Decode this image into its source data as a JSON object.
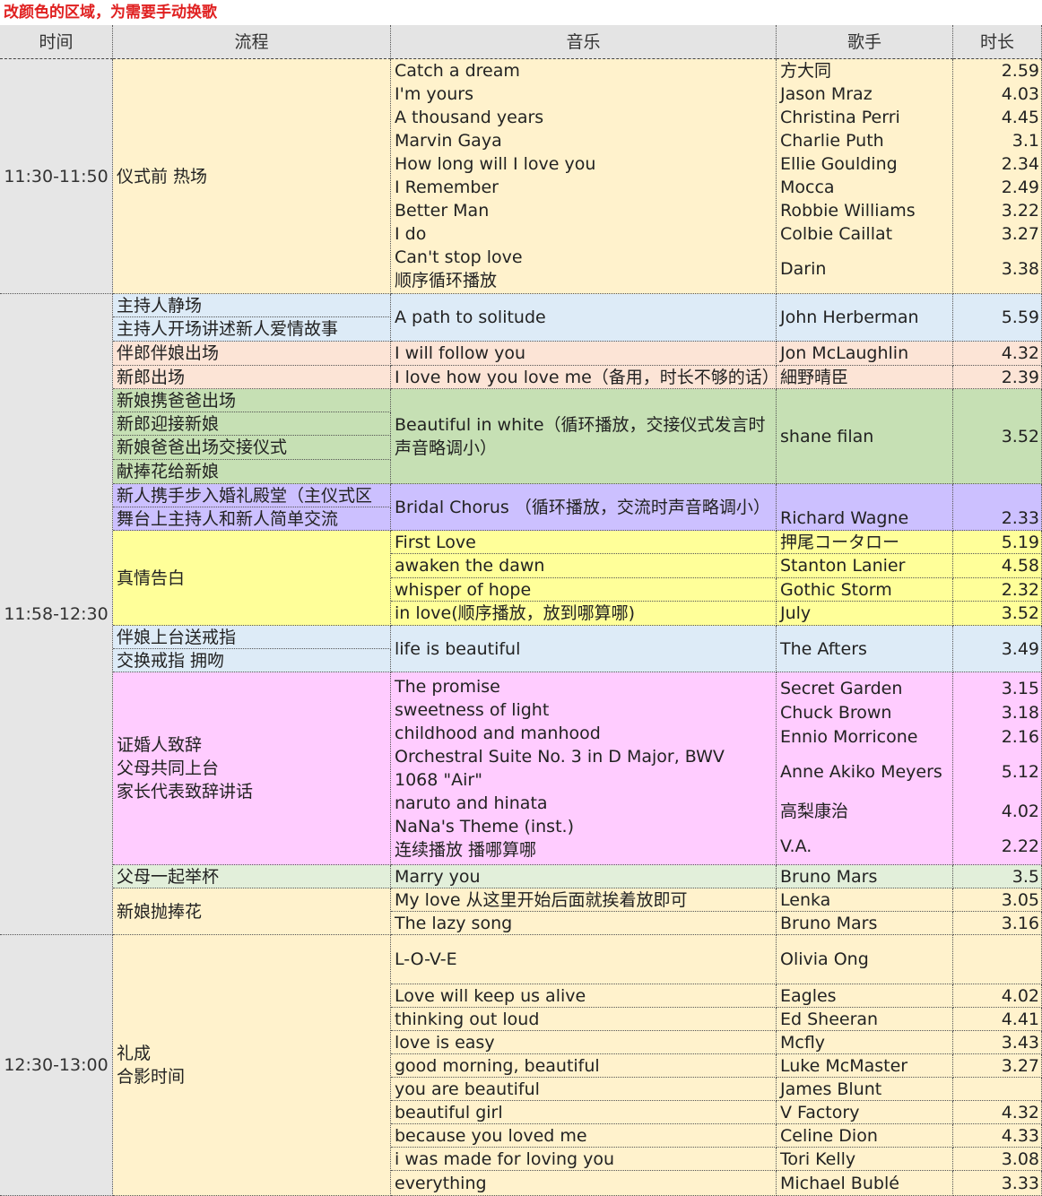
{
  "note": "改颜色的区域，为需要手动换歌",
  "headers": {
    "time": "时间",
    "process": "流程",
    "music": "音乐",
    "singer": "歌手",
    "duration": "时长"
  },
  "times": {
    "t1": "11:30-11:50",
    "t2": "11:58-12:30",
    "t3": "12:30-13:00"
  },
  "process": {
    "p1": "仪式前 热场",
    "p2": [
      "主持人静场",
      "主持人开场讲述新人爱情故事"
    ],
    "p3": [
      "伴郎伴娘出场",
      "新郎出场"
    ],
    "p4": [
      "新娘携爸爸出场",
      "新郎迎接新娘",
      "新娘爸爸出场交接仪式",
      "献捧花给新娘"
    ],
    "p5": [
      "新人携手步入婚礼殿堂（主仪式区",
      "舞台上主持人和新人简单交流"
    ],
    "p6": "真情告白",
    "p7": [
      "伴娘上台送戒指",
      "交换戒指 拥吻"
    ],
    "p8": [
      "证婚人致辞",
      "父母共同上台",
      "家长代表致辞讲话"
    ],
    "p9": "父母一起举杯",
    "p10": "新娘抛捧花",
    "p11": [
      "礼成",
      "合影时间"
    ]
  },
  "rows": {
    "r1": {
      "music": [
        "Catch a dream",
        "I'm yours",
        "A thousand years",
        "Marvin Gaya",
        "How long will I love you",
        "I Remember",
        "Better Man",
        "I do",
        "Can't stop love",
        "顺序循环播放"
      ],
      "singer": [
        "方大同",
        "Jason Mraz",
        "Christina Perri",
        "Charlie Puth",
        "Ellie Goulding",
        "Mocca",
        "Robbie Williams",
        "Colbie Caillat",
        "Darin"
      ],
      "dur": [
        "2.59",
        "4.03",
        "4.45",
        "3.1",
        "2.34",
        "2.49",
        "3.22",
        "3.27",
        "3.38"
      ]
    },
    "r2": {
      "music": "A path to solitude",
      "singer": "John Herberman",
      "dur": "5.59"
    },
    "r3a": {
      "music": "I will follow you",
      "singer": "Jon McLaughlin",
      "dur": "4.32"
    },
    "r3b": {
      "music": "I love how you love me（备用，时长不够的话）",
      "singer": "細野晴臣",
      "dur": "2.39"
    },
    "r4": {
      "music": "Beautiful in white（循环播放，交接仪式发言时声音略调小）",
      "singer": "shane filan",
      "dur": "3.52"
    },
    "r5": {
      "music": "Bridal Chorus （循环播放，交流时声音略调小）",
      "singer": "Richard Wagne",
      "dur": "2.33"
    },
    "r6": {
      "music": [
        "First Love",
        "awaken the dawn",
        "whisper of hope",
        "in love(顺序播放，放到哪算哪)"
      ],
      "singer": [
        "押尾コータロー",
        "Stanton Lanier",
        "Gothic Storm",
        "July"
      ],
      "dur": [
        "5.19",
        "4.58",
        "2.32",
        "3.52"
      ]
    },
    "r7": {
      "music": "life is beautiful",
      "singer": "The Afters",
      "dur": "3.49"
    },
    "r8": {
      "music": [
        "The promise",
        "sweetness of light",
        "childhood and manhood",
        "Orchestral Suite No. 3 in D Major, BWV 1068 \"Air\"",
        "naruto and hinata",
        "NaNa's Theme (inst.)",
        "连续播放 播哪算哪"
      ],
      "singer": [
        "Secret Garden",
        "Chuck Brown",
        "Ennio Morricone",
        "Anne Akiko Meyers",
        "高梨康治",
        "V.A."
      ],
      "dur": [
        "3.15",
        "3.18",
        "2.16",
        "5.12",
        "4.02",
        "2.22"
      ]
    },
    "r9": {
      "music": "Marry you",
      "singer": "Bruno Mars",
      "dur": "3.5"
    },
    "r10": {
      "music": [
        "My love 从这里开始后面就挨着放即可",
        "The lazy song"
      ],
      "singer": [
        "Lenka",
        "Bruno Mars"
      ],
      "dur": [
        "3.05",
        "3.16"
      ]
    },
    "r11a": {
      "music": "L-O-V-E",
      "singer": "Olivia Ong",
      "dur": ""
    },
    "r11": {
      "music": [
        "Love will keep us alive",
        "thinking out loud",
        "love is easy",
        "good morning, beautiful",
        "you are beautiful",
        "beautiful girl",
        "because you loved me",
        "i was made for loving you",
        "everything"
      ],
      "singer": [
        "Eagles",
        "Ed Sheeran",
        "Mcfly",
        "Luke McMaster",
        "James Blunt",
        "V Factory",
        "Celine Dion",
        "Tori Kelly",
        "Michael Bublé"
      ],
      "dur": [
        "4.02",
        "4.41",
        "3.43",
        "3.27",
        "",
        "4.32",
        "4.33",
        "3.08",
        "3.33"
      ]
    }
  },
  "colors": {
    "grey": "#e6e6e6",
    "yellow": "#fff2cc",
    "blue": "#ddebf7",
    "pink": "#fce4d6",
    "green": "#c6e0b4",
    "purple": "#ccc0ff",
    "brightyellow": "#ffff99",
    "magenta": "#ffccff",
    "lightgreen": "#e2efda"
  }
}
